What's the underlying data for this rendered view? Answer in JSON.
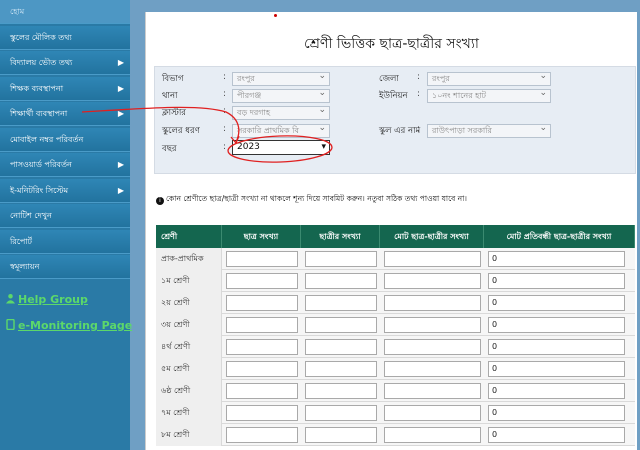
{
  "sidebar": {
    "items": [
      {
        "label": "হোম",
        "chevron": false
      },
      {
        "label": "স্কুলের মৌলিক তথ্য",
        "chevron": false
      },
      {
        "label": "বিদ্যালয় ভৌত তথ্য",
        "chevron": true
      },
      {
        "label": "শিক্ষক ব্যবস্থাপনা",
        "chevron": true
      },
      {
        "label": "শিক্ষার্থী ব্যবস্থাপনা",
        "chevron": true
      },
      {
        "label": "মোবাইল নম্বর পরিবর্তন",
        "chevron": false
      },
      {
        "label": "পাসওয়ার্ড পরিবর্তন",
        "chevron": true
      },
      {
        "label": "ই-মনিটরিং সিস্টেম",
        "chevron": true
      },
      {
        "label": "নোটিশ দেখুন",
        "chevron": false
      },
      {
        "label": "রিপোর্ট",
        "chevron": false
      },
      {
        "label": "স্বমূল্যায়ন",
        "chevron": false
      }
    ],
    "help_group": "Help Group",
    "monitoring_page": "e-Monitoring Page",
    "link_icon_color": "#5cd86a"
  },
  "main": {
    "title": "শ্রেণী ভিত্তিক ছাত্র-ছাত্রীর সংখ্যা",
    "filters": {
      "division_label": "বিভাগ",
      "division_value": "রংপুর",
      "district_label": "জেলা",
      "district_value": "রংপুর",
      "thana_label": "থানা",
      "thana_value": "পীরগঞ্জ",
      "union_label": "ইউনিয়ন",
      "union_value": "১০নং শানের হাট",
      "cluster_label": "ক্লাস্টার",
      "cluster_value": "বড় দরগাহ",
      "school_type_label": "স্কুলের ধরণ",
      "school_type_value": "সরকারি প্রাথমিক বি",
      "school_name_label": "স্কুল এর নাম",
      "school_name_value": "রাউৎপাড়া সরকারি",
      "year_label": "বছর",
      "year_value": "2023",
      "colon": ":"
    },
    "notice": "কোন শ্রেণীতে ছাত্র/ছাত্রী সংখ্যা না থাকলে শূন্য দিয়ে সাবমিট করুন। নতুবা সঠিক তথ্য পাওয়া যাবে না।",
    "table": {
      "headers": [
        "শ্রেণী",
        "ছাত্র সংখ্যা",
        "ছাত্রীর সংখ্যা",
        "মোট ছাত্র-ছাত্রীর সংখ্যা",
        "মোট প্রতিবন্ধী ছাত্র-ছাত্রীর সংখ্যা"
      ],
      "rows": [
        {
          "class": "প্রাক-প্রাথমিক",
          "boys": "",
          "girls": "",
          "total": "",
          "disabled": "0"
        },
        {
          "class": "১ম শ্রেণী",
          "boys": "",
          "girls": "",
          "total": "",
          "disabled": "0"
        },
        {
          "class": "২য় শ্রেণী",
          "boys": "",
          "girls": "",
          "total": "",
          "disabled": "0"
        },
        {
          "class": "৩য় শ্রেণী",
          "boys": "",
          "girls": "",
          "total": "",
          "disabled": "0"
        },
        {
          "class": "৪র্থ শ্রেণী",
          "boys": "",
          "girls": "",
          "total": "",
          "disabled": "0"
        },
        {
          "class": "৫ম শ্রেণী",
          "boys": "",
          "girls": "",
          "total": "",
          "disabled": "0"
        },
        {
          "class": "৬ষ্ঠ শ্রেণী",
          "boys": "",
          "girls": "",
          "total": "",
          "disabled": "0"
        },
        {
          "class": "৭ম শ্রেণী",
          "boys": "",
          "girls": "",
          "total": "",
          "disabled": "0"
        },
        {
          "class": "৮ম শ্রেণী",
          "boys": "",
          "girls": "",
          "total": "",
          "disabled": "0"
        }
      ]
    }
  },
  "colors": {
    "sidebar_bg": "#2a7aa6",
    "page_bg": "#6f9fc4",
    "table_header": "#14664f",
    "annotation": "#e02020"
  }
}
